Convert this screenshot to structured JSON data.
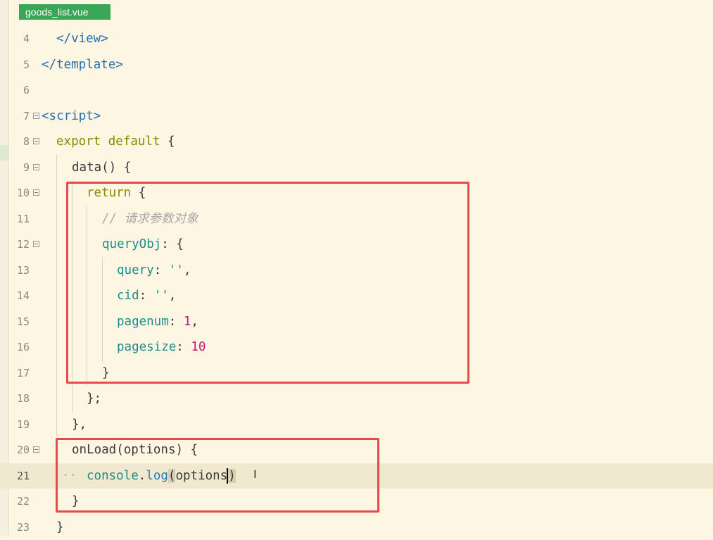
{
  "tab": {
    "filename": "goods_list.vue"
  },
  "lines": [
    {
      "num": "4",
      "text": "</view>"
    },
    {
      "num": "5",
      "text": "</template>"
    },
    {
      "num": "6",
      "text": ""
    },
    {
      "num": "7",
      "text": "<script>"
    },
    {
      "num": "8",
      "kw": "export default",
      "rest": " {"
    },
    {
      "num": "9",
      "text": "data() {"
    },
    {
      "num": "10",
      "kw": "return",
      "rest": " {"
    },
    {
      "num": "11",
      "text": "// 请求参数对象"
    },
    {
      "num": "12",
      "key": "queryObj",
      "rest": ": {"
    },
    {
      "num": "13",
      "key": "query",
      "sep": ": ",
      "val": "''",
      "end": ","
    },
    {
      "num": "14",
      "key": "cid",
      "sep": ": ",
      "val": "''",
      "end": ","
    },
    {
      "num": "15",
      "key": "pagenum",
      "sep": ": ",
      "val": "1",
      "end": ","
    },
    {
      "num": "16",
      "key": "pagesize",
      "sep": ": ",
      "val": "10",
      "end": ""
    },
    {
      "num": "17",
      "text": "}"
    },
    {
      "num": "18",
      "text": "};"
    },
    {
      "num": "19",
      "text": "},"
    },
    {
      "num": "20",
      "text": "onLoad(options) {"
    },
    {
      "num": "21",
      "obj": "console",
      "dot": ".",
      "method": "log",
      "open": "(",
      "arg": "options",
      "close": ")"
    },
    {
      "num": "22",
      "text": "}"
    },
    {
      "num": "23",
      "text": "}"
    }
  ],
  "colors": {
    "background": "#fdf6e3",
    "tab_green": "#3aa757",
    "highlight_red": "#e8494a",
    "current_line": "#f0e9d0"
  }
}
